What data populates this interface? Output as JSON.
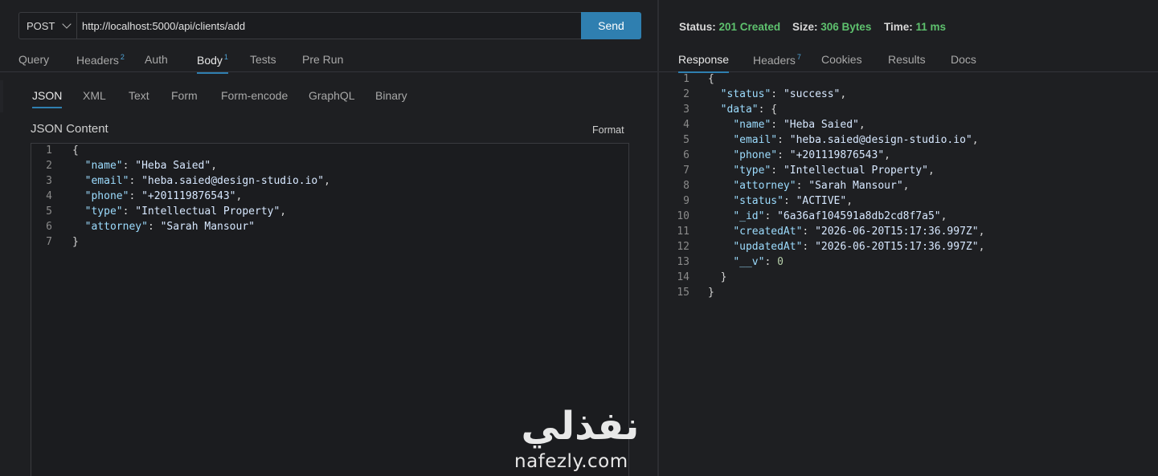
{
  "request": {
    "method": "POST",
    "url": "http://localhost:5000/api/clients/add",
    "send_label": "Send",
    "tabs": [
      {
        "label": "Query",
        "badge": ""
      },
      {
        "label": "Headers",
        "badge": "2"
      },
      {
        "label": "Auth",
        "badge": ""
      },
      {
        "label": "Body",
        "badge": "1"
      },
      {
        "label": "Tests",
        "badge": ""
      },
      {
        "label": "Pre Run",
        "badge": ""
      }
    ],
    "active_tab": "Body",
    "body_tabs": [
      "JSON",
      "XML",
      "Text",
      "Form",
      "Form-encode",
      "GraphQL",
      "Binary"
    ],
    "active_body_tab": "JSON",
    "content_label": "JSON Content",
    "format_label": "Format",
    "lines": [
      {
        "n": "1",
        "parts": [
          [
            "p",
            "{"
          ]
        ]
      },
      {
        "n": "2",
        "parts": [
          [
            "p",
            "  "
          ],
          [
            "k",
            "\"name\""
          ],
          [
            "p",
            ": "
          ],
          [
            "s2",
            "\"Heba Saied\""
          ],
          [
            "p",
            ","
          ]
        ]
      },
      {
        "n": "3",
        "parts": [
          [
            "p",
            "  "
          ],
          [
            "k",
            "\"email\""
          ],
          [
            "p",
            ": "
          ],
          [
            "s2",
            "\"heba.saied@design-studio.io\""
          ],
          [
            "p",
            ","
          ]
        ]
      },
      {
        "n": "4",
        "parts": [
          [
            "p",
            "  "
          ],
          [
            "k",
            "\"phone\""
          ],
          [
            "p",
            ": "
          ],
          [
            "s2",
            "\"+201119876543\""
          ],
          [
            "p",
            ","
          ]
        ]
      },
      {
        "n": "5",
        "parts": [
          [
            "p",
            "  "
          ],
          [
            "k",
            "\"type\""
          ],
          [
            "p",
            ": "
          ],
          [
            "s2",
            "\"Intellectual Property\""
          ],
          [
            "p",
            ","
          ]
        ]
      },
      {
        "n": "6",
        "parts": [
          [
            "p",
            "  "
          ],
          [
            "k",
            "\"attorney\""
          ],
          [
            "p",
            ": "
          ],
          [
            "s2",
            "\"Sarah Mansour\""
          ]
        ]
      },
      {
        "n": "7",
        "parts": [
          [
            "p",
            "}"
          ]
        ]
      }
    ]
  },
  "response": {
    "status_label": "Status:",
    "status_value": "201 Created",
    "size_label": "Size:",
    "size_value": "306 Bytes",
    "time_label": "Time:",
    "time_value": "11 ms",
    "tabs": [
      {
        "label": "Response",
        "badge": ""
      },
      {
        "label": "Headers",
        "badge": "7"
      },
      {
        "label": "Cookies",
        "badge": ""
      },
      {
        "label": "Results",
        "badge": ""
      },
      {
        "label": "Docs",
        "badge": ""
      }
    ],
    "active_tab": "Response",
    "lines": [
      {
        "n": "1",
        "parts": [
          [
            "p",
            "{"
          ]
        ]
      },
      {
        "n": "2",
        "parts": [
          [
            "p",
            "  "
          ],
          [
            "k",
            "\"status\""
          ],
          [
            "p",
            ": "
          ],
          [
            "s2",
            "\"success\""
          ],
          [
            "p",
            ","
          ]
        ]
      },
      {
        "n": "3",
        "parts": [
          [
            "p",
            "  "
          ],
          [
            "k",
            "\"data\""
          ],
          [
            "p",
            ": {"
          ]
        ]
      },
      {
        "n": "4",
        "parts": [
          [
            "p",
            "    "
          ],
          [
            "k",
            "\"name\""
          ],
          [
            "p",
            ": "
          ],
          [
            "s2",
            "\"Heba Saied\""
          ],
          [
            "p",
            ","
          ]
        ]
      },
      {
        "n": "5",
        "parts": [
          [
            "p",
            "    "
          ],
          [
            "k",
            "\"email\""
          ],
          [
            "p",
            ": "
          ],
          [
            "s2",
            "\"heba.saied@design-studio.io\""
          ],
          [
            "p",
            ","
          ]
        ]
      },
      {
        "n": "6",
        "parts": [
          [
            "p",
            "    "
          ],
          [
            "k",
            "\"phone\""
          ],
          [
            "p",
            ": "
          ],
          [
            "s2",
            "\"+201119876543\""
          ],
          [
            "p",
            ","
          ]
        ]
      },
      {
        "n": "7",
        "parts": [
          [
            "p",
            "    "
          ],
          [
            "k",
            "\"type\""
          ],
          [
            "p",
            ": "
          ],
          [
            "s2",
            "\"Intellectual Property\""
          ],
          [
            "p",
            ","
          ]
        ]
      },
      {
        "n": "8",
        "parts": [
          [
            "p",
            "    "
          ],
          [
            "k",
            "\"attorney\""
          ],
          [
            "p",
            ": "
          ],
          [
            "s2",
            "\"Sarah Mansour\""
          ],
          [
            "p",
            ","
          ]
        ]
      },
      {
        "n": "9",
        "parts": [
          [
            "p",
            "    "
          ],
          [
            "k",
            "\"status\""
          ],
          [
            "p",
            ": "
          ],
          [
            "s2",
            "\"ACTIVE\""
          ],
          [
            "p",
            ","
          ]
        ]
      },
      {
        "n": "10",
        "parts": [
          [
            "p",
            "    "
          ],
          [
            "k",
            "\"_id\""
          ],
          [
            "p",
            ": "
          ],
          [
            "s2",
            "\"6a36af104591a8db2cd8f7a5\""
          ],
          [
            "p",
            ","
          ]
        ]
      },
      {
        "n": "11",
        "parts": [
          [
            "p",
            "    "
          ],
          [
            "k",
            "\"createdAt\""
          ],
          [
            "p",
            ": "
          ],
          [
            "s2",
            "\"2026-06-20T15:17:36.997Z\""
          ],
          [
            "p",
            ","
          ]
        ]
      },
      {
        "n": "12",
        "parts": [
          [
            "p",
            "    "
          ],
          [
            "k",
            "\"updatedAt\""
          ],
          [
            "p",
            ": "
          ],
          [
            "s2",
            "\"2026-06-20T15:17:36.997Z\""
          ],
          [
            "p",
            ","
          ]
        ]
      },
      {
        "n": "13",
        "parts": [
          [
            "p",
            "    "
          ],
          [
            "k",
            "\"__v\""
          ],
          [
            "p",
            ": "
          ],
          [
            "n",
            "0"
          ]
        ]
      },
      {
        "n": "14",
        "parts": [
          [
            "p",
            "  }"
          ]
        ]
      },
      {
        "n": "15",
        "parts": [
          [
            "p",
            "}"
          ]
        ]
      }
    ]
  },
  "watermark": {
    "arabic": "نفذلي",
    "latin": "nafezly.com"
  },
  "colors": {
    "accent": "#2f7fb0",
    "status_green": "#5ec16e",
    "json_key": "#9cdcfe",
    "json_string": "#d7e8ff"
  }
}
